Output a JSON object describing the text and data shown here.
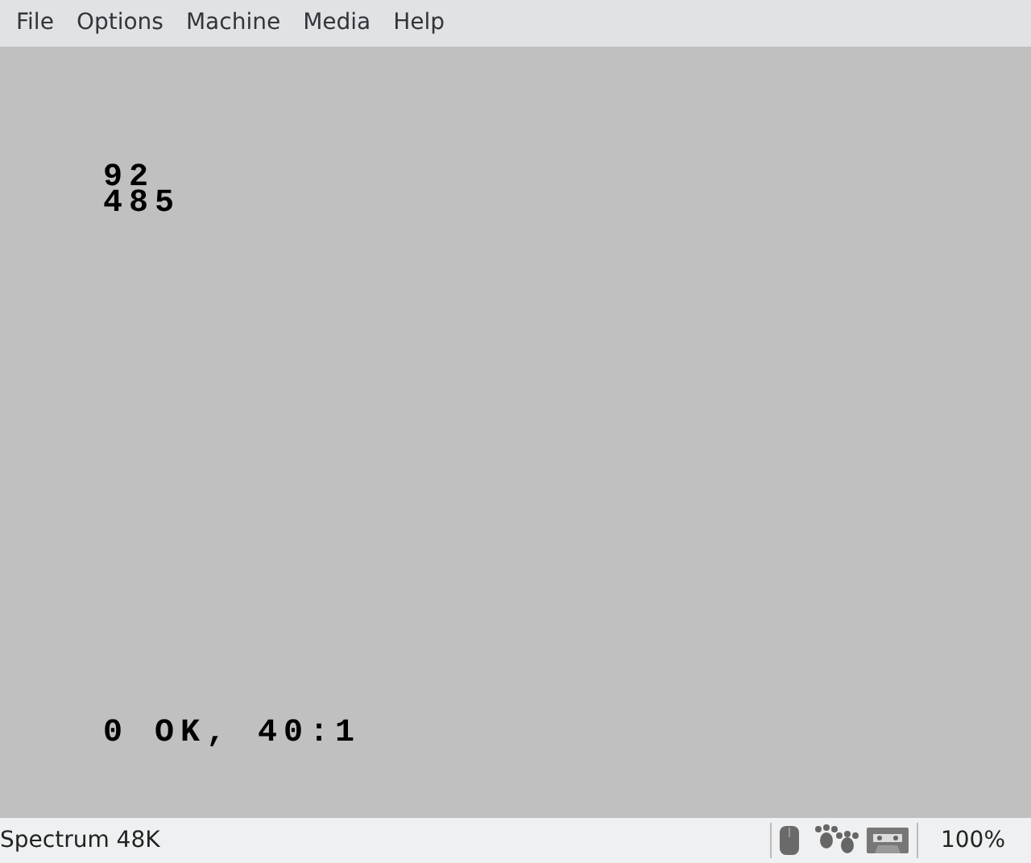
{
  "menu": [
    "File",
    "Options",
    "Machine",
    "Media",
    "Help"
  ],
  "screen": {
    "lines": [
      "92",
      "485"
    ],
    "message": "0 OK, 40:1"
  },
  "status_bar": {
    "machine": "Spectrum 48K",
    "zoom": "100%"
  }
}
